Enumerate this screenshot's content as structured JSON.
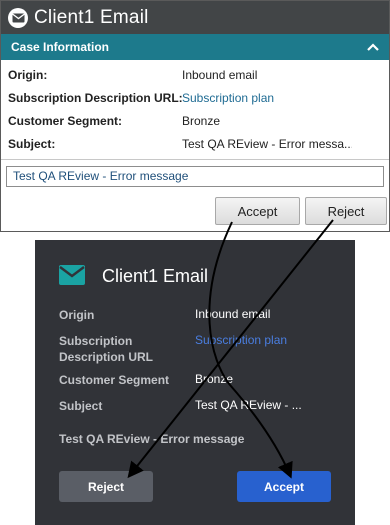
{
  "light_panel": {
    "title": "Client1 Email",
    "section_title": "Case Information",
    "fields": [
      {
        "label": "Origin:",
        "value": "Inbound email"
      },
      {
        "label": "Subscription Description URL:",
        "value": "Subscription plan"
      },
      {
        "label": "Customer Segment:",
        "value": "Bronze"
      },
      {
        "label": "Subject:",
        "value": "Test QA REview - Error messa..."
      }
    ],
    "subject_input_value": "Test QA REview - Error message",
    "accept_label": "Accept",
    "reject_label": "Reject"
  },
  "dark_panel": {
    "title": "Client1 Email",
    "fields": [
      {
        "label": "Origin",
        "value": "Inbound email"
      },
      {
        "label": "Subscription Description URL",
        "value": "Subscription plan"
      },
      {
        "label": "Customer Segment",
        "value": "Bronze"
      },
      {
        "label": "Subject",
        "value": "Test QA REview - ..."
      }
    ],
    "subject_full": "Test QA REview - Error message",
    "reject_label": "Reject",
    "accept_label": "Accept"
  },
  "colors": {
    "title_bar": "#424547",
    "section_header": "#1d7a8c",
    "dark_background": "#313338",
    "accent_blue": "#2861cf",
    "link": "#4a7ee0",
    "email_icon_teal": "#1aa3a3"
  },
  "icons": {
    "light_title_icon": "envelope-icon",
    "collapse_icon": "chevron-up-icon",
    "dark_title_icon": "envelope-icon"
  }
}
